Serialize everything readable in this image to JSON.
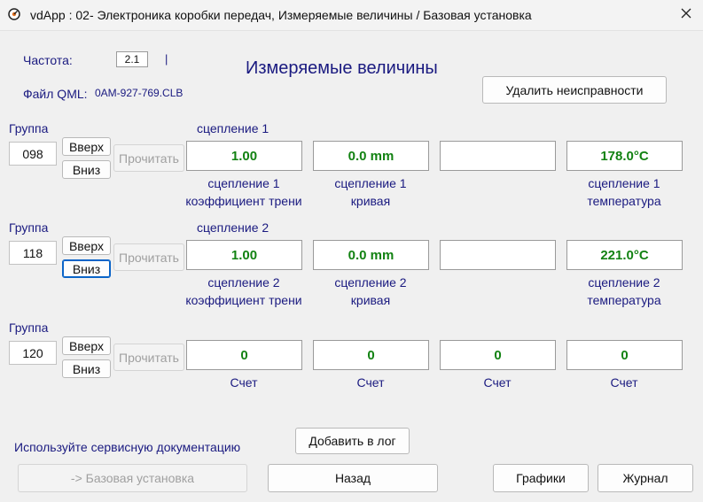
{
  "window": {
    "title": "vdApp : 02- Электроника коробки передач,  Измеряемые величины / Базовая установка"
  },
  "icons": {
    "app": "tachometer-icon",
    "close": "close-icon"
  },
  "colors": {
    "label_blue": "#1a1a80",
    "value_green": "#128212",
    "focus_blue": "#0a64c8"
  },
  "header": {
    "freq_label": "Частота:",
    "freq_value": "2.1",
    "freq_marker": "|",
    "qml_label": "Файл QML:",
    "qml_value": "0AM-927-769.CLB",
    "page_title": "Измеряемые величины",
    "clear_faults_button": "Удалить неисправности"
  },
  "groups": [
    {
      "group_label": "Группа",
      "number": "098",
      "up_button": "Вверх",
      "down_button": "Вниз",
      "read_button": "Прочитать",
      "section_title": "сцепление 1",
      "values": [
        "1.00",
        "0.0 mm",
        "",
        "178.0°C"
      ],
      "captions": [
        [
          "сцепление 1",
          "коэффициент трени"
        ],
        [
          "сцепление 1",
          "кривая"
        ],
        [
          "",
          ""
        ],
        [
          "сцепление 1",
          "температура"
        ]
      ]
    },
    {
      "group_label": "Группа",
      "number": "118",
      "up_button": "Вверх",
      "down_button": "Вниз",
      "read_button": "Прочитать",
      "section_title": "сцепление 2",
      "values": [
        "1.00",
        "0.0 mm",
        "",
        "221.0°C"
      ],
      "captions": [
        [
          "сцепление 2",
          "коэффициент трени"
        ],
        [
          "сцепление 2",
          "кривая"
        ],
        [
          "",
          ""
        ],
        [
          "сцепление 2",
          "температура"
        ]
      ]
    },
    {
      "group_label": "Группа",
      "number": "120",
      "up_button": "Вверх",
      "down_button": "Вниз",
      "read_button": "Прочитать",
      "section_title": "",
      "values": [
        "0",
        "0",
        "0",
        "0"
      ],
      "captions": [
        [
          "Счет",
          ""
        ],
        [
          "Счет",
          ""
        ],
        [
          "Счет",
          ""
        ],
        [
          "Счет",
          ""
        ]
      ]
    }
  ],
  "footer": {
    "service_doc_text": "Используйте сервисную документацию",
    "add_to_log_button": "Добавить в лог",
    "basic_setting_button": "-> Базовая установка",
    "back_button": "Назад",
    "graphs_button": "Графики",
    "journal_button": "Журнал"
  }
}
